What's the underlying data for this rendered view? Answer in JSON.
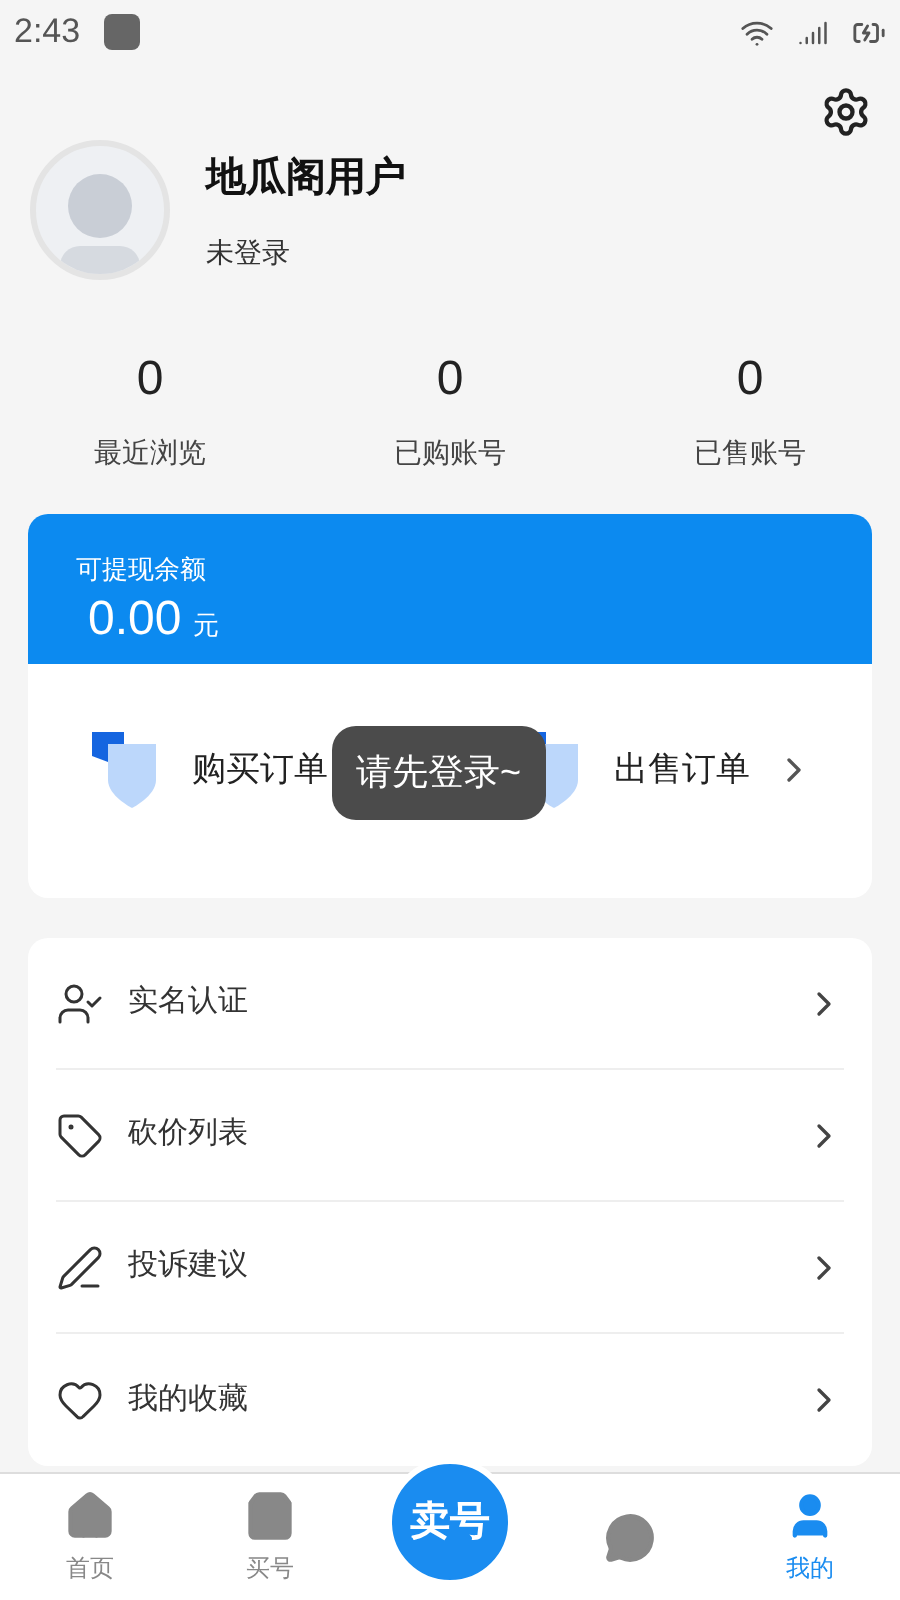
{
  "status_bar": {
    "time": "2:43"
  },
  "profile": {
    "name": "地瓜阁用户",
    "status": "未登录"
  },
  "stats": [
    {
      "value": "0",
      "label": "最近浏览"
    },
    {
      "value": "0",
      "label": "已购账号"
    },
    {
      "value": "0",
      "label": "已售账号"
    }
  ],
  "balance": {
    "label": "可提现余额",
    "amount": "0.00",
    "unit": "元"
  },
  "orders": [
    {
      "label": "购买订单"
    },
    {
      "label": "出售订单"
    }
  ],
  "toast": "请先登录~",
  "menu": [
    {
      "kind": "verify",
      "label": "实名认证"
    },
    {
      "kind": "bargain",
      "label": "砍价列表"
    },
    {
      "kind": "complaint",
      "label": "投诉建议"
    },
    {
      "kind": "favorite",
      "label": "我的收藏"
    }
  ],
  "bottom_nav": [
    {
      "kind": "home",
      "label": "首页",
      "selected": false
    },
    {
      "kind": "buy",
      "label": "买号",
      "selected": false
    },
    {
      "kind": "sell",
      "label": "卖号",
      "selected": false
    },
    {
      "kind": "message",
      "selected": false
    },
    {
      "kind": "me",
      "label": "我的",
      "selected": true
    }
  ]
}
